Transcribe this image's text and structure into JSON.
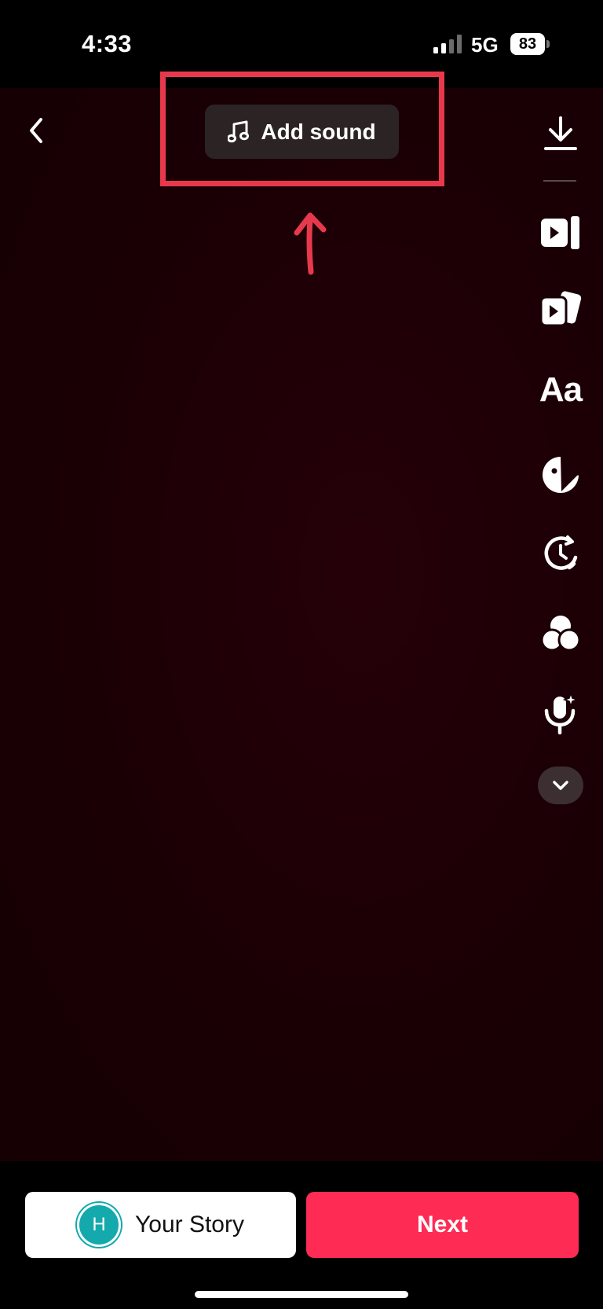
{
  "status_bar": {
    "time": "4:33",
    "network": "5G",
    "battery_level": "83",
    "signal_icon": "signal-bars-icon",
    "battery_icon": "battery-icon"
  },
  "editor": {
    "back_icon": "chevron-left-icon",
    "add_sound_label": "Add sound",
    "add_sound_icon": "music-note-icon",
    "highlight_color": "#e8394c",
    "tools": [
      {
        "name": "download",
        "icon": "download-icon"
      },
      {
        "name": "edit-clips",
        "icon": "edit-clips-icon"
      },
      {
        "name": "templates",
        "icon": "templates-icon"
      },
      {
        "name": "text",
        "icon": "text-icon",
        "label": "Aa"
      },
      {
        "name": "stickers",
        "icon": "sticker-icon"
      },
      {
        "name": "effects",
        "icon": "effects-timer-icon"
      },
      {
        "name": "filters",
        "icon": "filters-icon"
      },
      {
        "name": "voice-effects",
        "icon": "voice-effects-icon"
      },
      {
        "name": "more",
        "icon": "chevron-down-icon"
      }
    ]
  },
  "bottom_bar": {
    "avatar_initial": "H",
    "your_story_label": "Your Story",
    "next_label": "Next",
    "accent_color": "#fe2c55",
    "avatar_color": "#13a9ad"
  }
}
